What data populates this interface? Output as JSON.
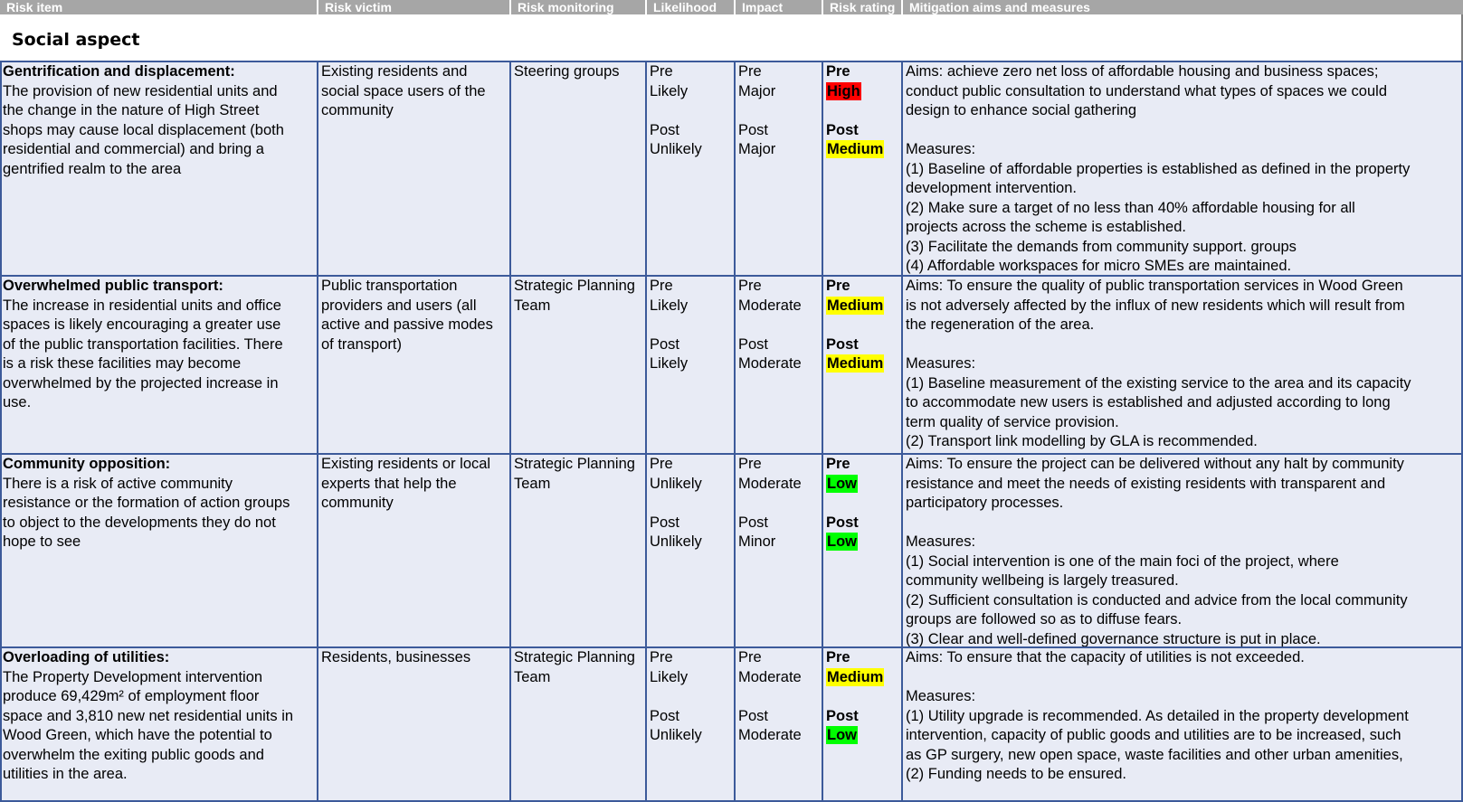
{
  "header": {
    "columns": [
      "Risk item",
      "Risk victim",
      "Risk monitoring",
      "Likelihood",
      "Impact",
      "Risk rating",
      "Mitigation aims and measures"
    ]
  },
  "section_title": "Social aspect",
  "rating_colors": {
    "High": "#ff0000",
    "Medium": "#ffff00",
    "Low": "#00ff00"
  },
  "rows": [
    {
      "item_title": "Gentrification and displacement:",
      "item_lines": [
        "The provision of new residential units and",
        "the change in the nature of High Street",
        "shops may cause local displacement (both",
        "residential and commercial) and bring a",
        "gentrified realm to the area"
      ],
      "victim_lines": [
        "Existing residents and",
        "social space users of the",
        "community"
      ],
      "monitoring_lines": [
        "Steering groups"
      ],
      "likelihood_lines": [
        "Pre",
        "Likely",
        "",
        "Post",
        "Unlikely"
      ],
      "impact_lines": [
        "Pre",
        "Major",
        "",
        "Post",
        "Major"
      ],
      "rating_pre_label": "Pre",
      "rating_pre": "High",
      "rating_post_label": "Post",
      "rating_post": "Medium",
      "mitigation_lines": [
        "Aims: achieve zero net loss of affordable housing and business spaces;",
        "conduct public consultation to understand what types of spaces we could",
        "design to enhance social gathering",
        "",
        "Measures:",
        "(1) Baseline of affordable properties is established as defined in the property",
        "development intervention.",
        "(2) Make sure a target of no less than 40% affordable housing for all",
        "projects across the scheme is established.",
        "(3) Facilitate the demands from community support. groups",
        "(4) Affordable workspaces for micro SMEs are maintained."
      ]
    },
    {
      "item_title": "Overwhelmed public transport:",
      "item_lines": [
        "The increase in residential units and office",
        "spaces is likely encouraging a greater use",
        "of the public transportation facilities. There",
        "is a risk these facilities may become",
        "overwhelmed by the projected increase in",
        "use."
      ],
      "victim_lines": [
        "Public transportation",
        "providers and users (all",
        "active and passive modes",
        "of transport)"
      ],
      "monitoring_lines": [
        "Strategic Planning",
        "Team"
      ],
      "likelihood_lines": [
        "Pre",
        "Likely",
        "",
        "Post",
        "Likely"
      ],
      "impact_lines": [
        "Pre",
        "Moderate",
        "",
        "Post",
        "Moderate"
      ],
      "rating_pre_label": "Pre",
      "rating_pre": "Medium",
      "rating_post_label": "Post",
      "rating_post": "Medium",
      "mitigation_lines": [
        "Aims: To ensure the quality of public transportation services in Wood Green",
        "is not adversely affected by the influx of new residents which will result from",
        "the regeneration of the area.",
        "",
        "Measures:",
        "(1) Baseline measurement of the existing service to the area and its capacity",
        "to accommodate new users is established and adjusted according to long",
        "term quality of service provision.",
        "(2) Transport link modelling by GLA is recommended."
      ]
    },
    {
      "item_title": "Community opposition:",
      "item_lines": [
        "There is a risk of active community",
        "resistance or the formation of action groups",
        "to object to the developments they do not",
        "hope to see"
      ],
      "victim_lines": [
        "Existing residents or local",
        "experts that help the",
        "community"
      ],
      "monitoring_lines": [
        "Strategic Planning",
        "Team"
      ],
      "likelihood_lines": [
        "Pre",
        "Unlikely",
        "",
        "Post",
        "Unlikely"
      ],
      "impact_lines": [
        "Pre",
        "Moderate",
        "",
        "Post",
        "Minor"
      ],
      "rating_pre_label": "Pre",
      "rating_pre": "Low",
      "rating_post_label": "Post",
      "rating_post": "Low",
      "mitigation_lines": [
        "Aims: To ensure the project can be delivered without any halt by community",
        "resistance and meet the needs of existing residents with transparent and",
        "participatory processes.",
        "",
        "Measures:",
        "(1) Social intervention is one of the main foci of the project, where",
        "community wellbeing is largely treasured.",
        "(2) Sufficient consultation is conducted and advice from the local community",
        "groups are followed so as to diffuse fears.",
        "(3) Clear and well-defined governance structure is put in place."
      ]
    },
    {
      "item_title": "Overloading of utilities:",
      "item_lines": [
        "The Property Development intervention",
        "produce 69,429m² of employment floor",
        "space and 3,810 new net residential units in",
        "Wood Green, which have the potential to",
        "overwhelm the exiting public goods and",
        "utilities in the area."
      ],
      "victim_lines": [
        "Residents, businesses"
      ],
      "monitoring_lines": [
        "Strategic Planning",
        "Team"
      ],
      "likelihood_lines": [
        "Pre",
        "Likely",
        "",
        "Post",
        "Unlikely"
      ],
      "impact_lines": [
        "Pre",
        "Moderate",
        "",
        "Post",
        "Moderate"
      ],
      "rating_pre_label": "Pre",
      "rating_pre": "Medium",
      "rating_post_label": "Post",
      "rating_post": "Low",
      "mitigation_lines": [
        "Aims: To ensure that the capacity of utilities is not exceeded.",
        "",
        "Measures:",
        "(1) Utility upgrade is recommended. As detailed in the property development",
        "intervention, capacity of public goods and utilities are to be increased, such",
        "as GP surgery, new open space, waste facilities and other urban amenities,",
        "(2) Funding needs to be ensured."
      ]
    }
  ]
}
